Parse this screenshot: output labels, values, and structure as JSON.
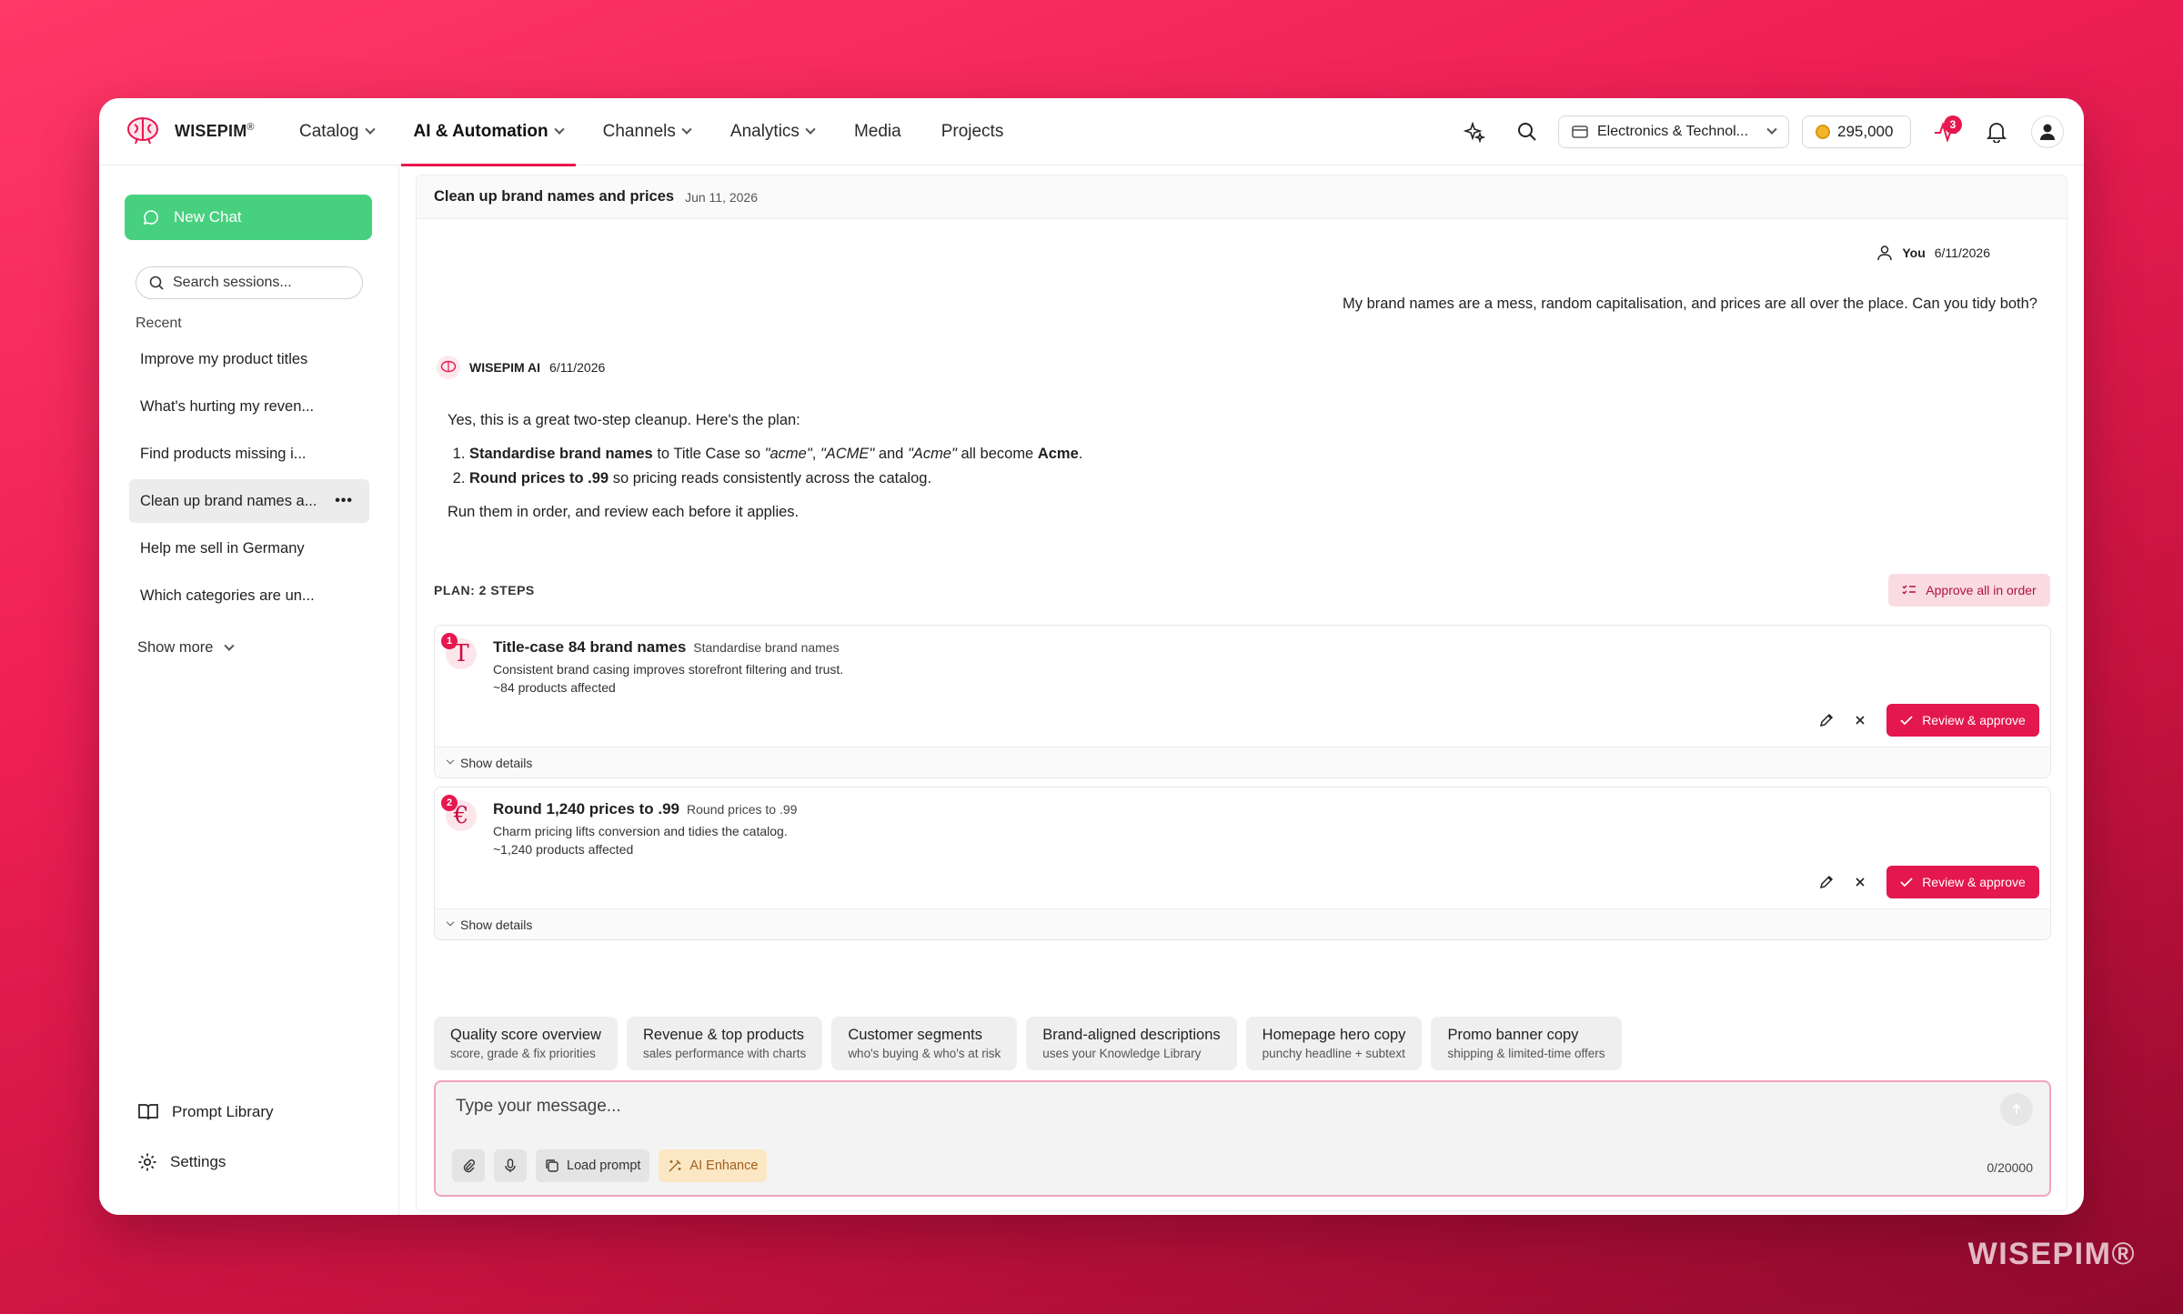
{
  "brand": {
    "name": "WISEPIM",
    "mark": "®"
  },
  "nav": {
    "items": [
      {
        "label": "Catalog",
        "dropdown": true
      },
      {
        "label": "AI & Automation",
        "dropdown": true,
        "active": true
      },
      {
        "label": "Channels",
        "dropdown": true
      },
      {
        "label": "Analytics",
        "dropdown": true
      },
      {
        "label": "Media",
        "dropdown": false
      },
      {
        "label": "Projects",
        "dropdown": false
      }
    ]
  },
  "topbar": {
    "store": "Electronics & Technol...",
    "credits": "295,000",
    "activity_badge": "3"
  },
  "sidebar": {
    "new_chat": "New Chat",
    "search_placeholder": "Search sessions...",
    "recent_label": "Recent",
    "sessions": [
      {
        "label": "Improve my product titles"
      },
      {
        "label": "What's hurting my reven..."
      },
      {
        "label": "Find products missing i..."
      },
      {
        "label": "Clean up brand names a...",
        "active": true
      },
      {
        "label": "Help me sell in Germany"
      },
      {
        "label": "Which categories are un..."
      }
    ],
    "show_more": "Show more",
    "prompt_library": "Prompt Library",
    "settings": "Settings"
  },
  "chat": {
    "title": "Clean up brand names and prices",
    "date": "Jun 11, 2026",
    "user": {
      "name": "You",
      "date": "6/11/2026",
      "message": "My brand names are a mess, random capitalisation, and prices are all over the place. Can you tidy both?"
    },
    "ai": {
      "name": "WISEPIM AI",
      "date": "6/11/2026",
      "intro": "Yes, this is a great two-step cleanup. Here's the plan:",
      "step1_bold": "Standardise brand names",
      "step1_text": " to Title Case so ",
      "step1_q1": "\"acme\"",
      "step1_sep1": ", ",
      "step1_q2": "\"ACME\"",
      "step1_and": " and ",
      "step1_q3": "\"Acme\"",
      "step1_tail": " all become ",
      "step1_end": "Acme",
      "step1_dot": ".",
      "step2_bold": "Round prices to .99",
      "step2_text": " so pricing reads consistently across the catalog.",
      "outro": "Run them in order, and review each before it applies."
    }
  },
  "plan": {
    "label": "PLAN: 2 STEPS",
    "approve_all": "Approve all in order",
    "steps": [
      {
        "number": "1",
        "glyph": "T",
        "title": "Title-case 84 brand names",
        "subtitle": "Standardise brand names",
        "desc": "Consistent brand casing improves storefront filtering and trust.",
        "affected": "~84 products affected",
        "review": "Review & approve",
        "details": "Show details"
      },
      {
        "number": "2",
        "glyph": "€",
        "title": "Round 1,240 prices to .99",
        "subtitle": "Round prices to .99",
        "desc": "Charm pricing lifts conversion and tidies the catalog.",
        "affected": "~1,240 products affected",
        "review": "Review & approve",
        "details": "Show details"
      }
    ]
  },
  "suggestions": [
    {
      "title": "Quality score overview",
      "sub": "score, grade & fix priorities"
    },
    {
      "title": "Revenue & top products",
      "sub": "sales performance with charts"
    },
    {
      "title": "Customer segments",
      "sub": "who's buying & who's at risk"
    },
    {
      "title": "Brand-aligned descriptions",
      "sub": "uses your Knowledge Library"
    },
    {
      "title": "Homepage hero copy",
      "sub": "punchy headline + subtext"
    },
    {
      "title": "Promo banner copy",
      "sub": "shipping & limited-time offers"
    }
  ],
  "composer": {
    "placeholder": "Type your message...",
    "load_prompt": "Load prompt",
    "ai_enhance": "AI Enhance",
    "counter": "0/20000"
  },
  "watermark": "WISEPIM®",
  "colors": {
    "accent": "#e8174f",
    "new_chat": "#47d17f",
    "background": "#ee1f55"
  }
}
